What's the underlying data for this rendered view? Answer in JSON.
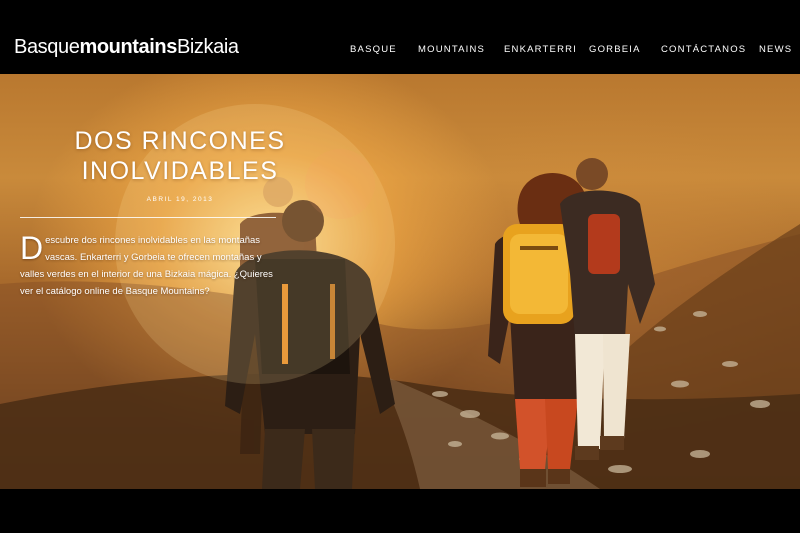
{
  "header": {
    "logo_light": "Basque",
    "logo_bold": "mountains",
    "logo_end": "Bizkaia"
  },
  "nav": {
    "items": [
      {
        "label": "BASQUE"
      },
      {
        "label": "MOUNTAINS"
      },
      {
        "label": "ENKARTERRI"
      },
      {
        "label": "GORBEIA"
      },
      {
        "label": "CONTÁCTANOS"
      },
      {
        "label": "NEWS"
      }
    ]
  },
  "hero": {
    "title_line1": "DOS RINCONES",
    "title_line2": "INOLVIDABLES",
    "date": "ABRIL 19, 2013",
    "dropcap": "D",
    "body": "escubre dos rincones inolvidables en las montañas vascas. Enkarterri y Gorbeia te ofrecen montañas y valles verdes en el interior de una Bizkaia mágica. ¿Quieres ver el catálogo online de Basque Mountains?"
  }
}
